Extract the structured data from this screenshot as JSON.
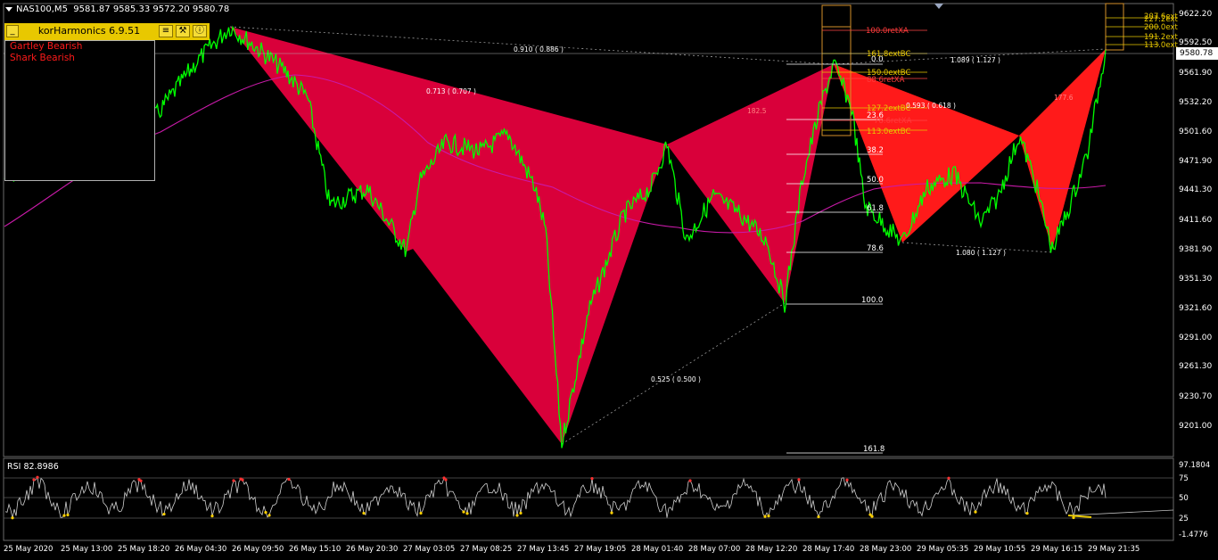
{
  "symbol_info": {
    "symbol": "NAS100,M5",
    "ohlc": "9581.87 9585.33 9572.20 9580.78"
  },
  "indicator": {
    "name": "korHarmonics 6.9.51",
    "buttons": [
      "_",
      "≡",
      "⚒",
      "ⓘ"
    ],
    "patterns": [
      "Gartley Bearish",
      "Shark Bearish"
    ]
  },
  "price_axis": {
    "labels": [
      "9622.20",
      "9592.50",
      "9561.90",
      "9532.20",
      "9501.60",
      "9471.90",
      "9441.30",
      "9411.60",
      "9381.90",
      "9351.30",
      "9321.60",
      "9291.00",
      "9261.30",
      "9230.70",
      "9201.00"
    ],
    "current_price": "9580.78",
    "current_price_color": "#ffffff"
  },
  "rsi": {
    "label": "RSI 82.8986",
    "axis_labels": [
      "97.1804",
      "75",
      "50",
      "25",
      "-1.4776"
    ]
  },
  "time_axis": {
    "labels": [
      "25 May 2020",
      "25 May 13:00",
      "25 May 18:20",
      "26 May 04:30",
      "26 May 09:50",
      "26 May 15:10",
      "26 May 20:30",
      "27 May 03:05",
      "27 May 08:25",
      "27 May 13:45",
      "27 May 19:05",
      "28 May 01:40",
      "28 May 07:00",
      "28 May 12:20",
      "28 May 17:40",
      "28 May 23:00",
      "29 May 05:35",
      "29 May 10:55",
      "29 May 16:15",
      "29 May 21:35"
    ]
  },
  "annotations": {
    "ratios": [
      "0.910 ( 0.886 )",
      "0.713 ( 0.707 )",
      "0.525 ( 0.500 )",
      "1.089 ( 1.127 )",
      "0.593 ( 0.618 )",
      "1.080 ( 1.127 )",
      "182.5",
      "177.6"
    ],
    "fib_levels": [
      "0.0",
      "23.6",
      "38.2",
      "50.0",
      "61.8",
      "78.6",
      "100.0",
      "161.8"
    ],
    "ext_labels": [
      "100.0retXA",
      "161.8extBC",
      "150.0extBC",
      "88.6retXA",
      "127.2extBC",
      "78.6retXA",
      "113.0extBC"
    ],
    "ext_labels_right": [
      "227.2ext",
      "200.0ext",
      "191.2ext",
      "113.0ext",
      "207.6ext"
    ]
  },
  "colors": {
    "bullish_line": "#00ff00",
    "harmonic_fill_1": "#d9003a",
    "harmonic_fill_2": "#ff1a1a",
    "ma_line": "#c81aa8",
    "panel_bg": "#e8c800"
  }
}
